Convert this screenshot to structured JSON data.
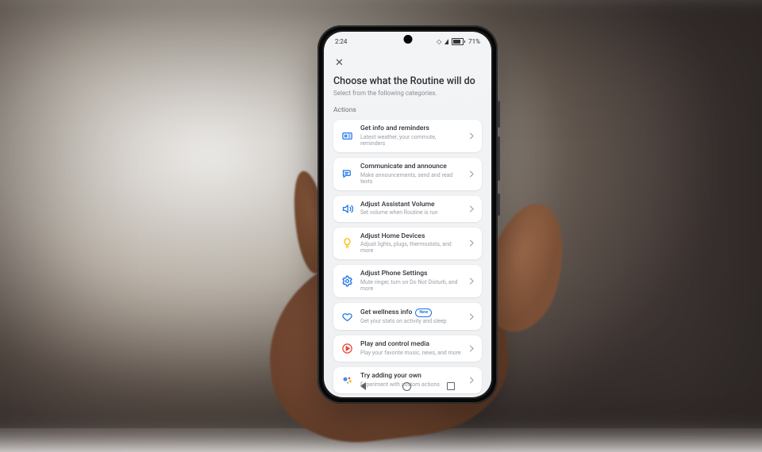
{
  "status": {
    "time": "2:24",
    "meta": "✦ ▸ ▪ •",
    "battery": "71%"
  },
  "header": {
    "close_label": "✕",
    "title": "Choose what the Routine will do",
    "subtitle": "Select from the following categories."
  },
  "section_label": "Actions",
  "badge_new": "New",
  "actions": [
    {
      "id": "info",
      "title": "Get info and reminders",
      "desc": "Latest weather, your commute, reminders"
    },
    {
      "id": "communicate",
      "title": "Communicate and announce",
      "desc": "Make announcements, send and read texts"
    },
    {
      "id": "volume",
      "title": "Adjust Assistant Volume",
      "desc": "Set volume when Routine is run"
    },
    {
      "id": "home",
      "title": "Adjust Home Devices",
      "desc": "Adjust lights, plugs, thermostats, and more"
    },
    {
      "id": "phone",
      "title": "Adjust Phone Settings",
      "desc": "Mute ringer, turn on Do Not Disturb, and more"
    },
    {
      "id": "wellness",
      "title": "Get wellness info",
      "desc": "Get your stats on activity and sleep",
      "badge": true
    },
    {
      "id": "media",
      "title": "Play and control media",
      "desc": "Play your favorite music, news, and more"
    },
    {
      "id": "custom",
      "title": "Try adding your own",
      "desc": "Experiment with custom actions"
    }
  ],
  "icons": {
    "info": "id-card-icon",
    "communicate": "chat-icon",
    "volume": "volume-icon",
    "home": "lightbulb-icon",
    "phone": "settings-icon",
    "wellness": "heart-icon",
    "media": "play-icon",
    "custom": "assistant-icon"
  },
  "nav": {
    "back": "Back",
    "home": "Home",
    "recent": "Recent"
  }
}
